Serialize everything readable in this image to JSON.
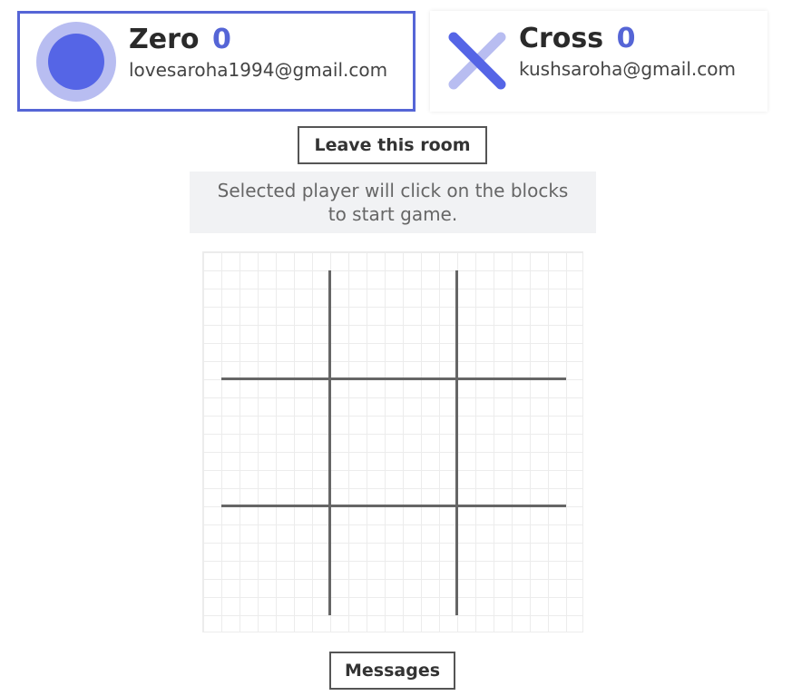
{
  "players": {
    "zero": {
      "name": "Zero",
      "score": "0",
      "email": "lovesaroha1994@gmail.com",
      "active": true
    },
    "cross": {
      "name": "Cross",
      "score": "0",
      "email": "kushsaroha@gmail.com",
      "active": false
    }
  },
  "actions": {
    "leave_label": "Leave this room",
    "messages_label": "Messages"
  },
  "status": {
    "text": "Selected player will click on the blocks to start game."
  },
  "board": {
    "cells": [
      "",
      "",
      "",
      "",
      "",
      "",
      "",
      "",
      ""
    ]
  },
  "colors": {
    "accent": "#5565d6",
    "accent_light": "#b8bdf1",
    "grid_line": "#666666",
    "status_bg": "#f1f2f4"
  },
  "icons": {
    "zero": "circle-icon",
    "cross": "cross-icon"
  }
}
